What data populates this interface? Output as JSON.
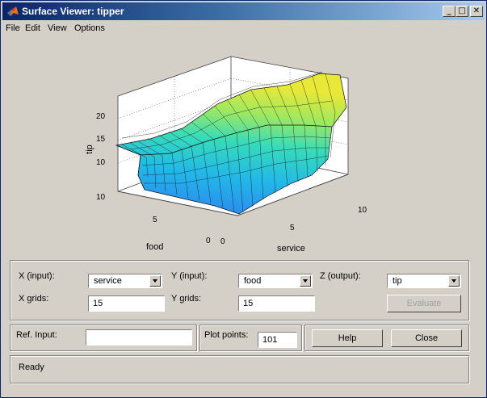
{
  "window": {
    "title": "Surface Viewer: tipper",
    "minimize_glyph": "_",
    "maximize_glyph": "□",
    "close_glyph": "✕"
  },
  "menu": [
    "File",
    "Edit",
    "View",
    "Options"
  ],
  "plot": {
    "zlabel": "tip",
    "xlabel": "service",
    "ylabel": "food",
    "z_ticks": [
      "20",
      "15",
      "10",
      "10"
    ],
    "service_ticks": [
      "0",
      "5",
      "10"
    ],
    "food_ticks": [
      "10",
      "5",
      "0"
    ]
  },
  "controls": {
    "x_input_label": "X (input):",
    "x_input_value": "service",
    "y_input_label": "Y (input):",
    "y_input_value": "food",
    "z_output_label": "Z (output):",
    "z_output_value": "tip",
    "x_grids_label": "X grids:",
    "x_grids_value": "15",
    "y_grids_label": "Y grids:",
    "y_grids_value": "15",
    "evaluate_label": "Evaluate",
    "ref_input_label": "Ref. Input:",
    "ref_input_value": "",
    "plot_points_label": "Plot points:",
    "plot_points_value": "101",
    "help_label": "Help",
    "close_label": "Close"
  },
  "status": "Ready",
  "colors": {
    "titlebar_start": "#0a246a",
    "titlebar_end": "#a6caf0",
    "face": "#d4d0c8"
  },
  "icons": {
    "app": "matlab-logo-icon",
    "dropdown": "chevron-down-icon"
  }
}
